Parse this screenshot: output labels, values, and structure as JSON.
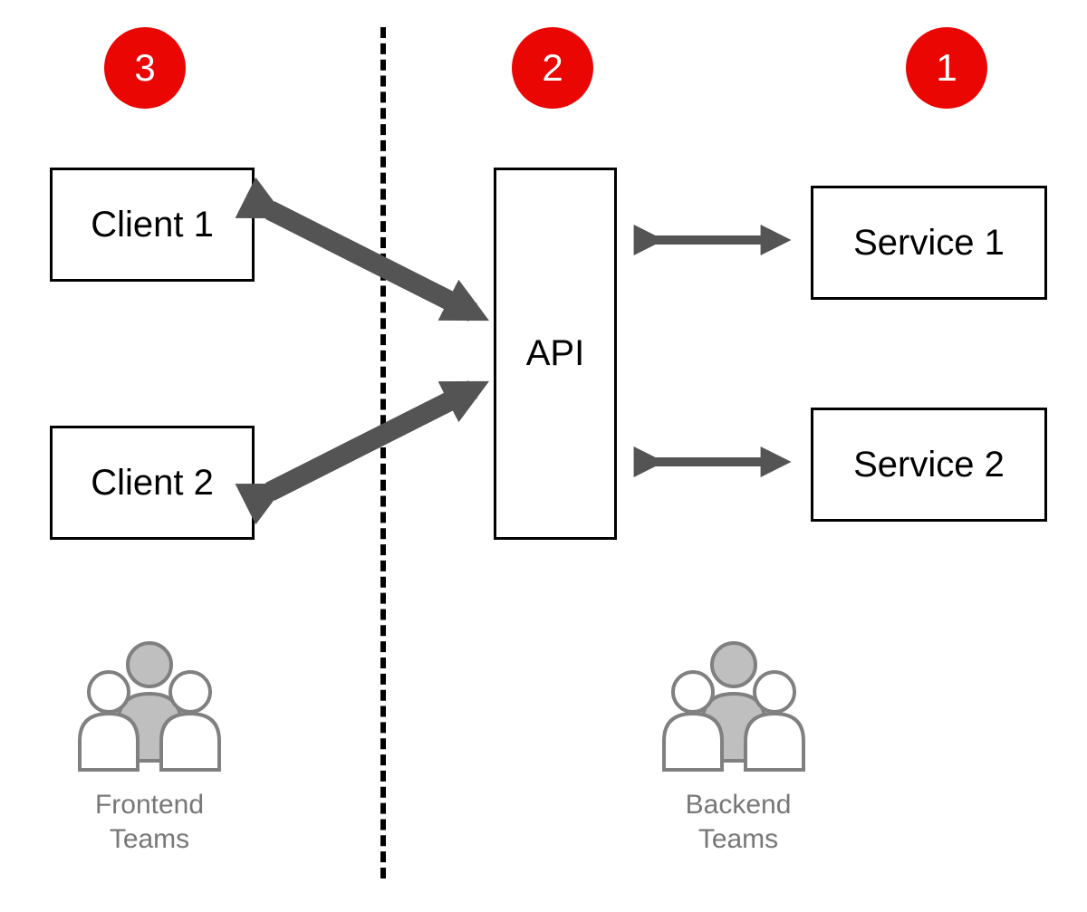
{
  "badges": {
    "left": {
      "number": "3"
    },
    "middle": {
      "number": "2"
    },
    "right": {
      "number": "1"
    }
  },
  "boxes": {
    "client1": "Client 1",
    "client2": "Client 2",
    "api": "API",
    "service1": "Service 1",
    "service2": "Service 2"
  },
  "teams": {
    "frontend": "Frontend\nTeams",
    "backend": "Backend\nTeams"
  },
  "colors": {
    "badge": "#ea0603",
    "arrow": "#545454",
    "label": "#777777",
    "iconFill": "#bfbfbf",
    "iconStroke": "#808080"
  }
}
